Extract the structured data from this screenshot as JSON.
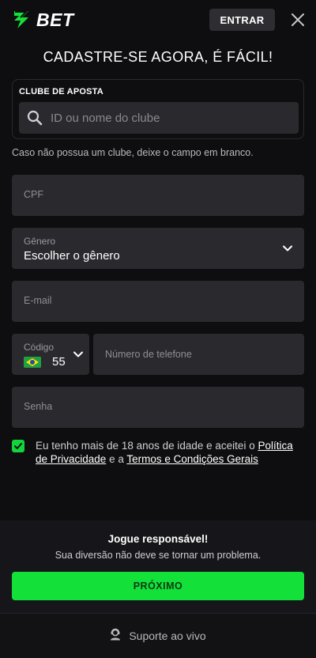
{
  "header": {
    "logo_text": "BET",
    "enter_label": "ENTRAR"
  },
  "title": "CADASTRE-SE AGORA, É FÁCIL!",
  "club": {
    "label": "CLUBE DE APOSTA",
    "placeholder": "ID ou nome do clube",
    "hint": "Caso não possua um clube, deixe o campo em branco."
  },
  "form": {
    "cpf_placeholder": "CPF",
    "gender": {
      "label": "Gênero",
      "value": "Escolher o gênero"
    },
    "email_placeholder": "E-mail",
    "phone": {
      "code_label": "Código",
      "code_value": "55",
      "number_placeholder": "Número de telefone"
    },
    "password_placeholder": "Senha"
  },
  "terms": {
    "checked": true,
    "text_prefix": "Eu tenho mais de 18 anos de idade e aceitei o ",
    "privacy_link": "Política de Privacidade",
    "middle": " e a ",
    "terms_link": "Termos e Condições Gerais"
  },
  "footer": {
    "responsible_title": "Jogue responsável!",
    "responsible_sub": "Sua diversão não deve se tornar um problema.",
    "next_label": "PRÓXIMO",
    "support_label": "Suporte ao vivo"
  },
  "icons": {
    "logo": "logo-mark-icon",
    "close": "close-icon",
    "search": "search-icon",
    "chevron": "chevron-down-icon",
    "flag": "brazil-flag-icon",
    "check": "check-icon",
    "support": "support-agent-icon"
  },
  "colors": {
    "accent": "#13e13a",
    "background": "#0e0e10",
    "field": "#2a2a2e"
  }
}
